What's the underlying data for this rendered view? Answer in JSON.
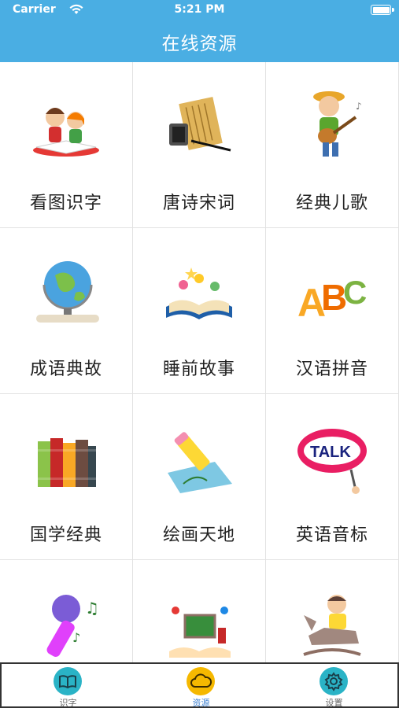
{
  "status_bar": {
    "carrier": "Carrier",
    "time": "5:21 PM"
  },
  "header": {
    "title": "在线资源"
  },
  "grid": {
    "items": [
      {
        "label": "看图识字",
        "icon": "kids-reading-icon"
      },
      {
        "label": "唐诗宋词",
        "icon": "scroll-ink-icon"
      },
      {
        "label": "经典儿歌",
        "icon": "boy-guitar-icon"
      },
      {
        "label": "成语典故",
        "icon": "globe-icon"
      },
      {
        "label": "睡前故事",
        "icon": "storybook-icon"
      },
      {
        "label": "汉语拼音",
        "icon": "abc-letters-icon"
      },
      {
        "label": "国学经典",
        "icon": "books-icon"
      },
      {
        "label": "绘画天地",
        "icon": "pencil-drawing-icon"
      },
      {
        "label": "英语音标",
        "icon": "talk-sign-icon"
      },
      {
        "label": "",
        "icon": "microphone-icon"
      },
      {
        "label": "",
        "icon": "classroom-icon"
      },
      {
        "label": "",
        "icon": "boy-rocking-horse-icon"
      }
    ]
  },
  "tabbar": {
    "items": [
      {
        "label": "识字",
        "icon": "book-icon",
        "color": "#2ab3c6"
      },
      {
        "label": "资源",
        "icon": "cloud-icon",
        "color": "#f5b800"
      },
      {
        "label": "设置",
        "icon": "gear-icon",
        "color": "#2ab3c6"
      }
    ],
    "active": "资源"
  }
}
